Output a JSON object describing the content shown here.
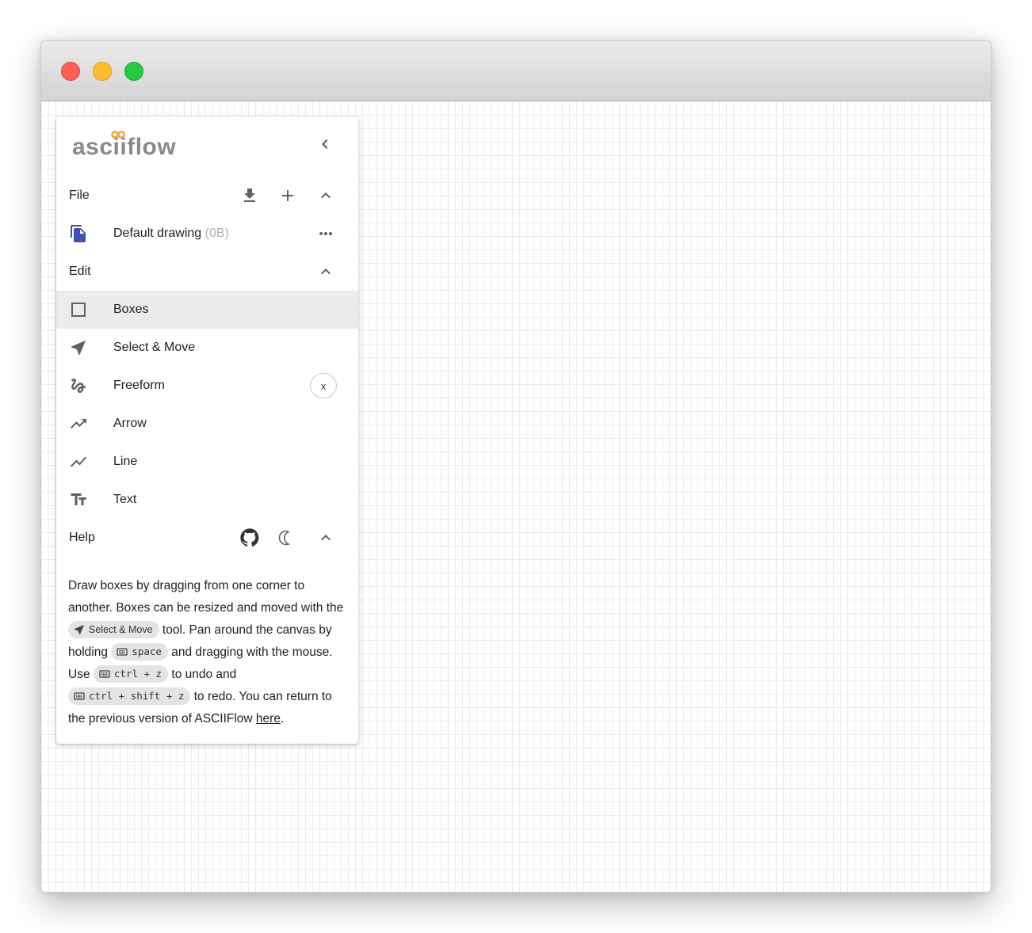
{
  "window": {
    "traffic_lights": [
      "close",
      "minimize",
      "zoom"
    ]
  },
  "sidebar": {
    "logo_text": "asciiflow",
    "file_section": {
      "title": "File",
      "drawing": {
        "name": "Default drawing",
        "size": "(0B)"
      }
    },
    "edit_section": {
      "title": "Edit",
      "tools": [
        {
          "label": "Boxes",
          "icon": "box-outline-icon",
          "selected": true
        },
        {
          "label": "Select & Move",
          "icon": "navigation-arrow-icon"
        },
        {
          "label": "Freeform",
          "icon": "gesture-icon",
          "shortcut_chip": "x"
        },
        {
          "label": "Arrow",
          "icon": "trending-up-arrow-icon"
        },
        {
          "label": "Line",
          "icon": "show-chart-icon"
        },
        {
          "label": "Text",
          "icon": "text-fields-icon"
        }
      ]
    },
    "help_section": {
      "title": "Help",
      "text": {
        "p1": "Draw boxes by dragging from one corner to another. Boxes can be resized and moved with the ",
        "chip_select": "Select & Move",
        "p2": " tool. Pan around the canvas by holding ",
        "chip_space": "space",
        "p3": " and dragging with the mouse. Use ",
        "chip_undo": "ctrl + z",
        "p4": " to undo and ",
        "chip_redo": "ctrl + shift + z",
        "p5": " to redo. You can return to the previous version of ASCIIFlow ",
        "link": "here",
        "p6": "."
      }
    }
  },
  "colors": {
    "logo_gray": "#8a8a8a",
    "logo_orange": "#f0a033",
    "file_icon_blue": "#3f51b5",
    "icon_gray": "#616161"
  }
}
